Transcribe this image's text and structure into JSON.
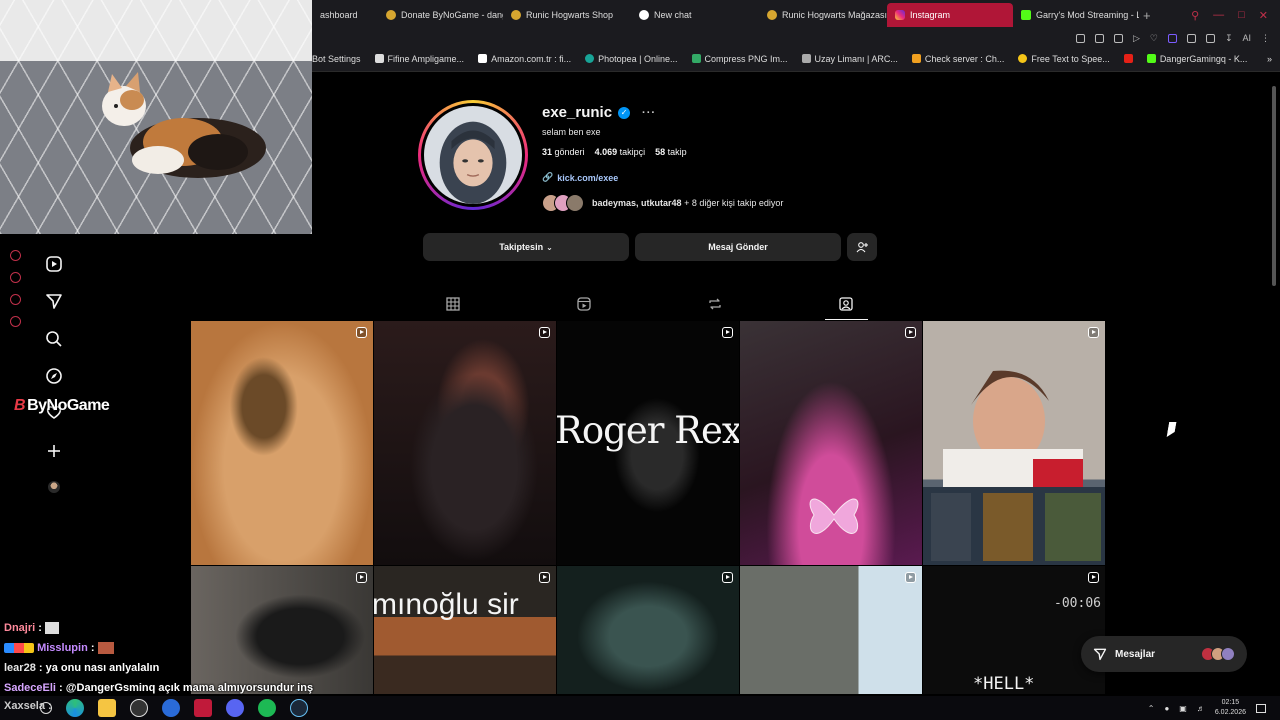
{
  "browser": {
    "tabs": [
      {
        "label": "ashboard",
        "active": false
      },
      {
        "label": "Donate ByNoGame - dang",
        "active": false
      },
      {
        "label": "Runic Hogwarts Shop",
        "active": false
      },
      {
        "label": "New chat",
        "active": false
      },
      {
        "label": "Runic Hogwarts Mağazası",
        "active": false
      },
      {
        "label": "Instagram",
        "active": true
      },
      {
        "label": "Garry's Mod Streaming - L",
        "active": false
      }
    ],
    "new_tab": "+",
    "toolbar_ai": "AI",
    "bookmarks": [
      "Bot Settings",
      "Fifine Ampligame...",
      "Amazon.com.tr : fi...",
      "Photopea | Online...",
      "Compress PNG Im...",
      "Uzay Limanı | ARC...",
      "Check server : Ch...",
      "Free Text to Spee...",
      "DangerGamingq - K..."
    ]
  },
  "overlay": {
    "brand": "ByNoGame",
    "brand_mark": "B"
  },
  "profile": {
    "username": "exe_runic",
    "bio": "selam ben exe",
    "posts_count": "31",
    "posts_label": "gönderi",
    "followers_count": "4.069",
    "followers_label": "takipçi",
    "following_count": "58",
    "following_label": "takip",
    "link": "kick.com/exee",
    "followed_by_names": "badeymas, utkutar48",
    "followed_by_rest": "+ 8 diğer kişi takip ediyor",
    "follow_button": "Takiptesin",
    "message_button": "Mesaj Gönder"
  },
  "grid_text": {
    "roger": "Roger Rex",
    "minoglu": "mınoğlu sir",
    "timer": "-00:06",
    "hell": "*HELL*"
  },
  "messages_pill": {
    "label": "Mesajlar"
  },
  "chat": [
    {
      "nick": "Dnajri",
      "sep": " :",
      "msg": ""
    },
    {
      "nick": "Misslupin",
      "sep": " :",
      "msg": ""
    },
    {
      "nick": "lear28",
      "sep": " :",
      "msg": " ya onu nası anlyalalın"
    },
    {
      "nick": "SadeceEli",
      "sep": " :",
      "msg": " @DangerGsminq açık mama almıyorsundur inş"
    },
    {
      "nick": "Xaxsela",
      "sep": " :",
      "msg": ""
    }
  ],
  "taskbar": {
    "time": "02:15",
    "date": "6.02.2026"
  },
  "colors": {
    "accent_tab": "#b01637",
    "link_blue": "#a8c7fa",
    "verified": "#0095f6",
    "button_bg": "#262626"
  }
}
